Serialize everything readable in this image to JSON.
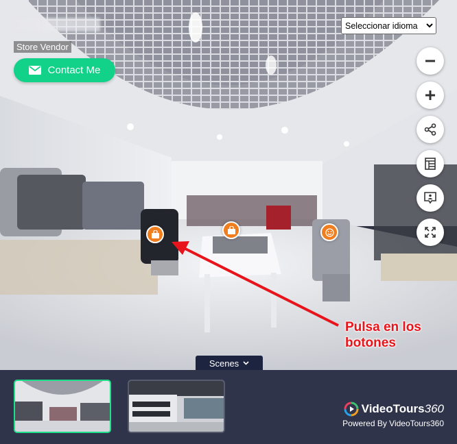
{
  "vendor": {
    "name": "Store Vendor"
  },
  "contact_button": {
    "label": "Contact Me"
  },
  "language_select": {
    "selected": "Seleccionar idioma"
  },
  "annotation": {
    "line1": "Pulsa en los",
    "line2": "botones"
  },
  "scenes_tab": {
    "label": "Scenes"
  },
  "brand": {
    "name_bold": "VideoTours",
    "name_italic": "360",
    "tagline": "Powered By VideoTours360"
  },
  "colors": {
    "accent_green": "#12d28a",
    "hotspot_orange": "#f07d1e",
    "annotation_red": "#e8141b",
    "bottom_bar": "#30344a",
    "scenes_tab": "#1d2440"
  },
  "icons": [
    "envelope-icon",
    "zoom-out-icon",
    "zoom-in-icon",
    "share-icon",
    "panel-layout-icon",
    "message-icon",
    "fullscreen-icon",
    "shopping-bag-icon",
    "smiley-icon",
    "chevron-down-icon",
    "videotours-logo-icon"
  ]
}
